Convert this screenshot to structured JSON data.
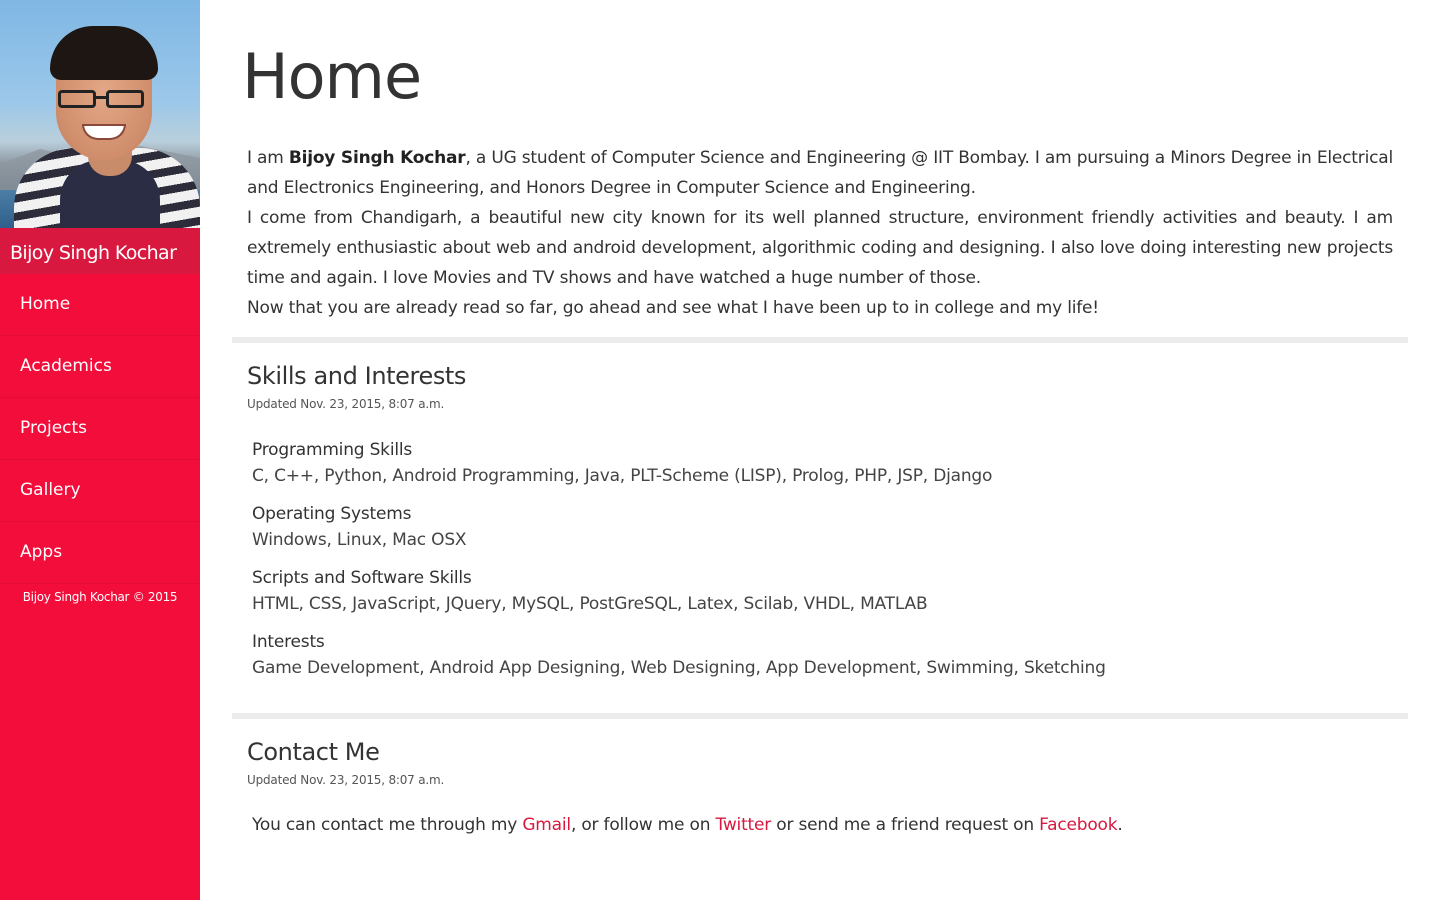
{
  "sidebar": {
    "name": "Bijoy Singh Kochar",
    "nav": [
      {
        "label": "Home"
      },
      {
        "label": "Academics"
      },
      {
        "label": "Projects"
      },
      {
        "label": "Gallery"
      },
      {
        "label": "Apps"
      }
    ],
    "footer": "Bijoy Singh Kochar © 2015",
    "accent_color": "#f20d3a"
  },
  "main": {
    "title": "Home",
    "intro": {
      "p1_prefix": "I am ",
      "p1_name": "Bijoy Singh Kochar",
      "p1_suffix": ", a UG student of Computer Science and Engineering @ IIT Bombay. I am pursuing a Minors Degree in Electrical and Electronics Engineering, and Honors Degree in Computer Science and Engineering.",
      "p2": "I come from Chandigarh, a beautiful new city known for its well planned structure, environment friendly activities and beauty. I am extremely enthusiastic about web and android development, algorithmic coding and designing. I also love doing interesting new projects time and again. I love Movies and TV shows and have watched a huge number of those.",
      "p3": "Now that you are already read so far, go ahead and see what I have been up to in college and my life!"
    },
    "skills": {
      "title": "Skills and Interests",
      "updated": "Updated Nov. 23, 2015, 8:07 a.m.",
      "items": [
        {
          "heading": "Programming Skills",
          "value": "C, C++, Python, Android Programming, Java, PLT-Scheme (LISP), Prolog, PHP, JSP, Django"
        },
        {
          "heading": "Operating Systems",
          "value": "Windows, Linux, Mac OSX"
        },
        {
          "heading": "Scripts and Software Skills",
          "value": "HTML, CSS, JavaScript, JQuery, MySQL, PostGreSQL, Latex, Scilab, VHDL, MATLAB"
        },
        {
          "heading": "Interests",
          "value": "Game Development, Android App Designing, Web Designing, App Development, Swimming, Sketching"
        }
      ]
    },
    "contact": {
      "title": "Contact Me",
      "updated": "Updated Nov. 23, 2015, 8:07 a.m.",
      "text_1": "You can contact me through my ",
      "gmail": "Gmail",
      "text_2": ", or follow me on ",
      "twitter": "Twitter",
      "text_3": " or send me a friend request on ",
      "facebook": "Facebook",
      "text_4": ".",
      "link_color": "#d8183f"
    }
  }
}
